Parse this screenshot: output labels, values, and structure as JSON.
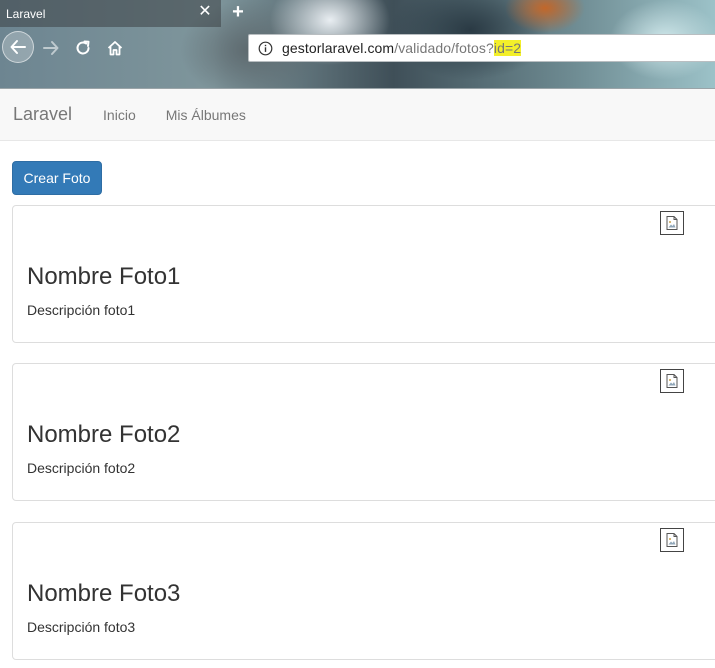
{
  "browser": {
    "tab_title": "Laravel",
    "tab_close": "✕",
    "new_tab": "+",
    "url": {
      "host": "gestorlaravel.com",
      "path": "/validado/fotos?",
      "query_highlight": "id=2"
    },
    "icons": {
      "back": "back-arrow-icon",
      "forward": "forward-arrow-icon",
      "reload": "reload-icon",
      "home": "home-icon",
      "info": "info-icon"
    },
    "colors": {
      "highlight": "#f3ef2a"
    }
  },
  "navbar": {
    "brand": "Laravel",
    "links": [
      "Inicio",
      "Mis Álbumes"
    ]
  },
  "main": {
    "create_button": "Crear Foto",
    "photos": [
      {
        "title": "Nombre Foto1",
        "description": "Descripción foto1",
        "image_icon": "broken-image-icon"
      },
      {
        "title": "Nombre Foto2",
        "description": "Descripción foto2",
        "image_icon": "broken-image-icon"
      },
      {
        "title": "Nombre Foto3",
        "description": "Descripción foto3",
        "image_icon": "broken-image-icon"
      }
    ]
  },
  "colors": {
    "primary": "#337ab7",
    "navbar_bg": "#f8f8f8",
    "nav_text": "#777777",
    "text": "#333333"
  }
}
